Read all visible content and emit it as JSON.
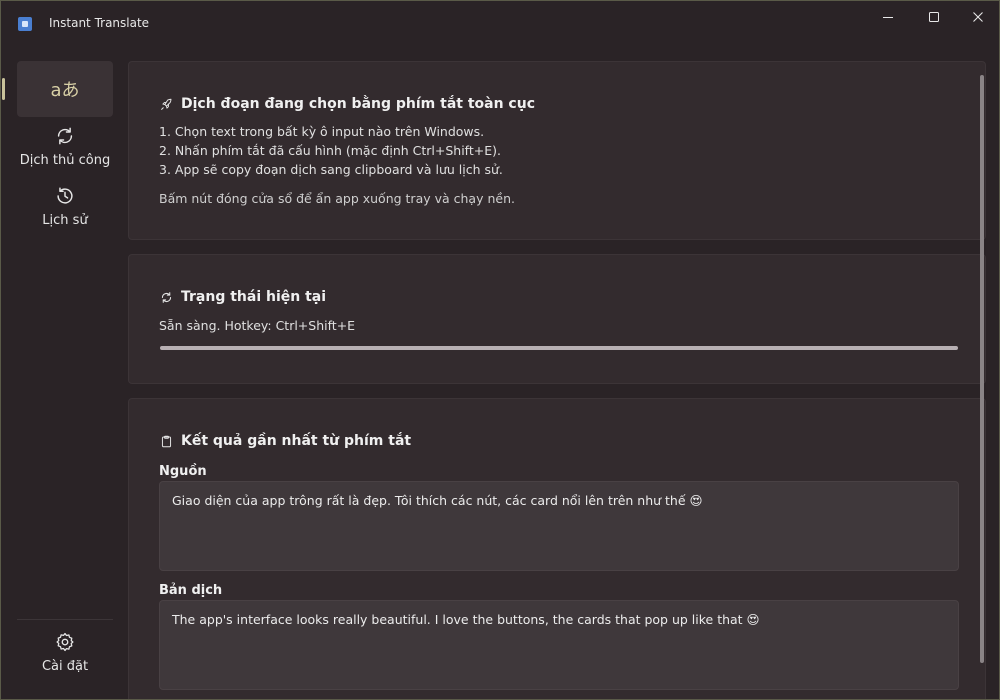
{
  "window": {
    "title": "Instant Translate"
  },
  "sidebar": {
    "items": [
      {
        "label": "",
        "icon": "translate-icon",
        "glyph": "aあ",
        "selected": true
      },
      {
        "label": "Dịch thủ công",
        "icon": "sync-icon"
      },
      {
        "label": "Lịch sử",
        "icon": "history-icon"
      }
    ],
    "footer": {
      "label": "Cài đặt",
      "icon": "gear-icon"
    }
  },
  "cards": {
    "hotkey": {
      "title": "Dịch đoạn đang chọn bằng phím tắt toàn cục",
      "steps": [
        "1. Chọn text trong bất kỳ ô input nào trên Windows.",
        "2. Nhấn phím tắt đã cấu hình (mặc định Ctrl+Shift+E).",
        "3. App sẽ copy đoạn dịch sang clipboard và lưu lịch sử."
      ],
      "note": "Bấm nút đóng cửa sổ để ẩn app xuống tray và chạy nền."
    },
    "status": {
      "title": "Trạng thái hiện tại",
      "text": "Sẵn sàng. Hotkey: Ctrl+Shift+E",
      "progress": 1.0
    },
    "result": {
      "title": "Kết quả gần nhất từ phím tắt",
      "source_label": "Nguồn",
      "source_text": "Giao diện của app trông rất là đẹp. Tôi thích các nút, các card nổi lên trên như thế 😍",
      "translation_label": "Bản dịch",
      "translation_text": "The app's interface looks really beautiful. I love the buttons, the cards that pop up like that 😍"
    }
  },
  "colors": {
    "window_bg": "#2a2326",
    "card_bg": "#332b2e",
    "accent": "#c9c29a",
    "textbox_bg": "#3f383b"
  }
}
